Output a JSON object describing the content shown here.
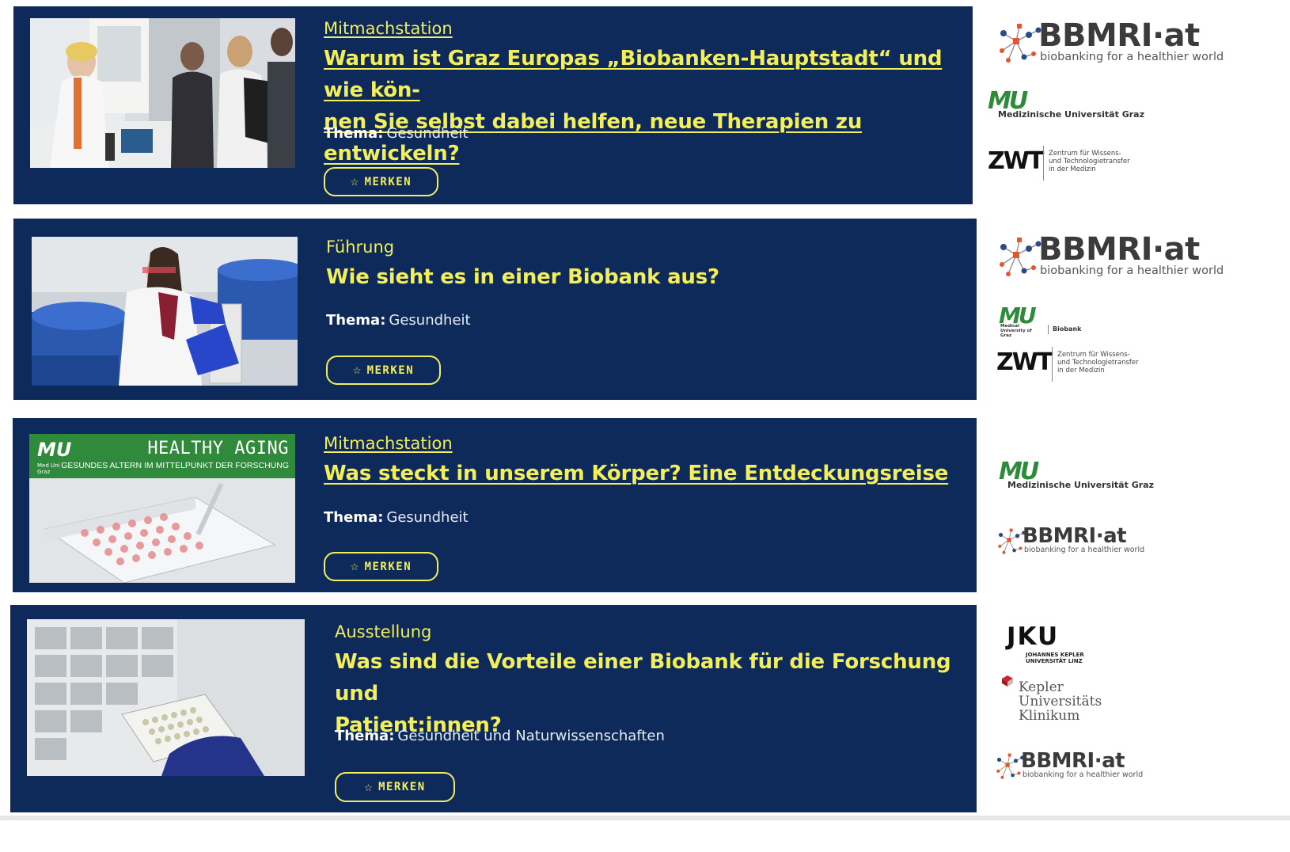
{
  "events": [
    {
      "category": "Mitmachstation",
      "title_line1": "Warum ist Graz Europas „Biobanken-Hauptstadt“ und wie kön-",
      "title_line2": "nen Sie selbst dabei helfen, neue Therapien zu entwickeln?",
      "theme_label": "Thema:",
      "theme_value": "Gesundheit",
      "button_label": "MERKEN",
      "image_icon": "lab-visitors-photo"
    },
    {
      "category": "Führung",
      "title_line1": "Wie sieht es in einer Biobank aus?",
      "title_line2": "",
      "theme_label": "Thema:",
      "theme_value": "Gesundheit",
      "button_label": "MERKEN",
      "image_icon": "biobank-freezer-photo"
    },
    {
      "category": "Mitmachstation",
      "title_line1": "Was steckt in unserem Körper? Eine Entdeckungsreise",
      "title_line2": "",
      "theme_label": "Thema:",
      "theme_value": "Gesundheit",
      "button_label": "MERKEN",
      "image_icon": "well-plate-photo",
      "image_banner": {
        "logo": "MU",
        "logo_sub": "Med Uni Graz",
        "headline": "HEALTHY AGING",
        "subline": "GESUNDES ALTERN IM MITTELPUNKT DER FORSCHUNG"
      }
    },
    {
      "category": "Ausstellung",
      "title_line1": "Was sind die Vorteile einer Biobank für die Forschung und",
      "title_line2": "Patient:innen?",
      "theme_label": "Thema:",
      "theme_value": "Gesundheit und Naturwissenschaften",
      "button_label": "MERKEN",
      "image_icon": "sample-rack-photo"
    }
  ],
  "logos": {
    "bbmri": {
      "name": "BBMRI·at",
      "tagline": "biobanking for a healthier world"
    },
    "mug": {
      "mark": "MU",
      "name": "Medizinische Universität Graz"
    },
    "mug_biobank": {
      "mark": "MU",
      "sub": "Medical University of Graz",
      "label": "Biobank"
    },
    "zwt": {
      "mark": "ZWT",
      "line1": "Zentrum für Wissens-",
      "line2": "und Technologietransfer",
      "line3": "in der Medizin"
    },
    "jku": {
      "mark": "JKU",
      "line1": "JOHANNES KEPLER",
      "line2": "UNIVERSITÄT LINZ"
    },
    "kuk": {
      "line1": "Kepler",
      "line2": "Universitäts",
      "line3": "Klinikum"
    }
  },
  "colors": {
    "card_bg": "#0d2a5a",
    "accent": "#f3ef5a",
    "bbmri_orange": "#e8542b",
    "bbmri_blue": "#2a4a8a",
    "mug_green": "#2e8b3a",
    "kuk_red": "#d2232a"
  }
}
